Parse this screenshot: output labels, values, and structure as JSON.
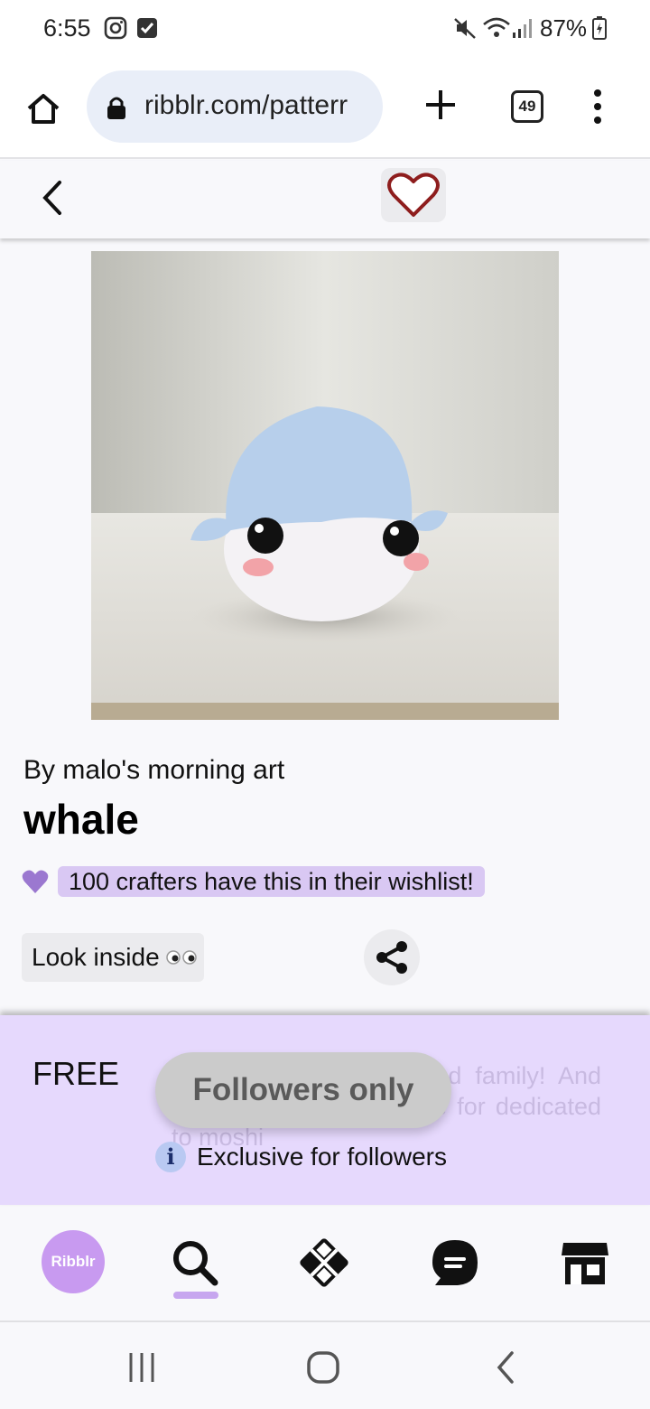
{
  "status_bar": {
    "time": "6:55",
    "battery": "87%",
    "icons": [
      "instagram-icon",
      "checkbox-icon",
      "mute-icon",
      "wifi-icon",
      "signal-icon",
      "battery-charging-icon"
    ]
  },
  "browser": {
    "url": "ribblr.com/patterr",
    "tab_count": "49",
    "icons": [
      "home-icon",
      "lock-icon",
      "plus-icon",
      "tabs-icon",
      "menu-icon"
    ]
  },
  "app_bar": {
    "icons": [
      "back-chevron-icon",
      "heart-outline-icon"
    ]
  },
  "pattern": {
    "image_alt": "whale",
    "byline": "By malo's morning art",
    "title": "whale",
    "wishlist_text": "100 crafters have this in their wishlist!",
    "look_inside": "Look inside",
    "share_icon": "share-icon"
  },
  "panel": {
    "price": "FREE",
    "followers_only": "Followers only",
    "exclusive_text": "Exclusive for followers",
    "faded_description": "I made which is the and family! And don't forget to make one for dedicated to moshi",
    "info_icon_glyph": "i"
  },
  "bottom_nav": {
    "logo_text": "Ribblr",
    "items": [
      "search-icon",
      "patterns-icon",
      "chat-icon",
      "shop-icon"
    ],
    "active": "search-icon"
  },
  "colors": {
    "lavender_panel": "#e6d9fd",
    "wishlist_pill": "#d9c8f3",
    "heart_purple": "#9b78d0",
    "logo_purple": "#c89af0",
    "heart_outline_red": "#8e1d1d"
  },
  "system_nav": {
    "icons": [
      "recents-icon",
      "home-circle-icon",
      "back-icon"
    ]
  }
}
